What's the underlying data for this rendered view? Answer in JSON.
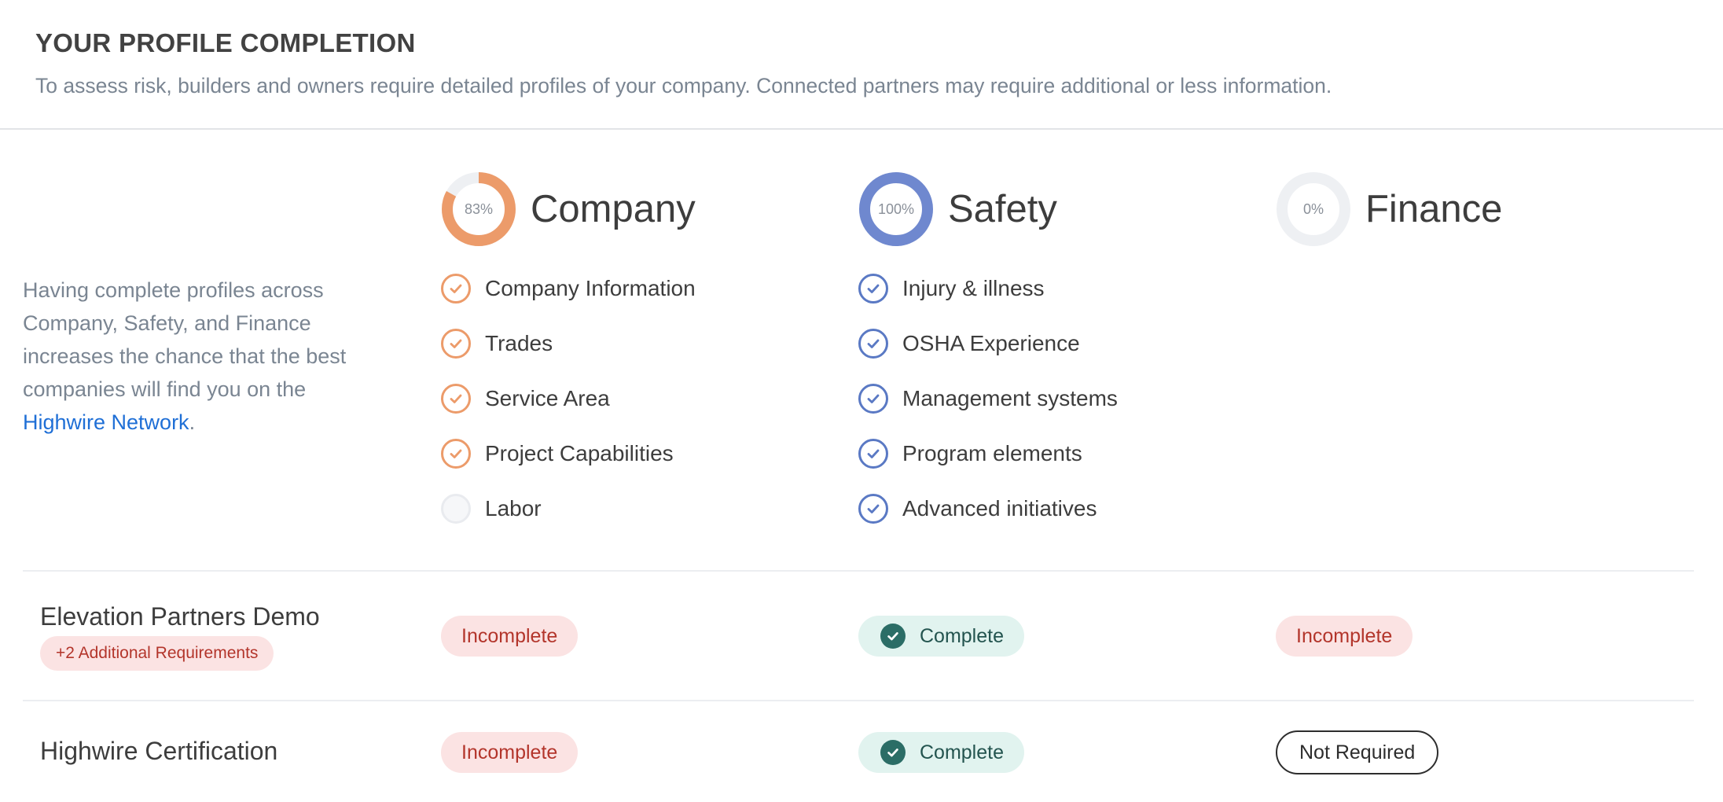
{
  "header": {
    "title": "YOUR PROFILE COMPLETION",
    "subtitle": "To assess risk, builders and owners require detailed profiles of your company. Connected partners may require additional or less information."
  },
  "intro": {
    "text": "Having complete profiles across Company, Safety, and Finance increases the chance that the best companies will find you on the ",
    "link_text": "Highwire Network",
    "suffix": "."
  },
  "columns": [
    {
      "title": "Company",
      "percent_label": "83%",
      "percent": 83,
      "color": "#ec9b6a",
      "items": [
        {
          "label": "Company Information",
          "done": true
        },
        {
          "label": "Trades",
          "done": true
        },
        {
          "label": "Service Area",
          "done": true
        },
        {
          "label": "Project Capabilities",
          "done": true
        },
        {
          "label": "Labor",
          "done": false
        }
      ]
    },
    {
      "title": "Safety",
      "percent_label": "100%",
      "percent": 100,
      "color": "#6f88cf",
      "items": [
        {
          "label": "Injury & illness",
          "done": true
        },
        {
          "label": "OSHA Experience",
          "done": true
        },
        {
          "label": "Management systems",
          "done": true
        },
        {
          "label": "Program elements",
          "done": true
        },
        {
          "label": "Advanced initiatives",
          "done": true
        }
      ]
    },
    {
      "title": "Finance",
      "percent_label": "0%",
      "percent": 0,
      "color": "#eceef2",
      "items": []
    }
  ],
  "rows": [
    {
      "name": "Elevation Partners Demo",
      "badge": "+2 Additional Requirements",
      "company": "Incomplete",
      "safety": "Complete",
      "finance": "Incomplete"
    },
    {
      "name": "Highwire Certification",
      "company": "Incomplete",
      "safety": "Complete",
      "finance": "Not Required"
    }
  ],
  "colors": {
    "accent_link": "#1f6fd6",
    "incomplete_bg": "#fbe3e3",
    "incomplete_text": "#b3352b",
    "complete_bg": "#e1f3ef",
    "complete_dot": "#2b6d66"
  }
}
